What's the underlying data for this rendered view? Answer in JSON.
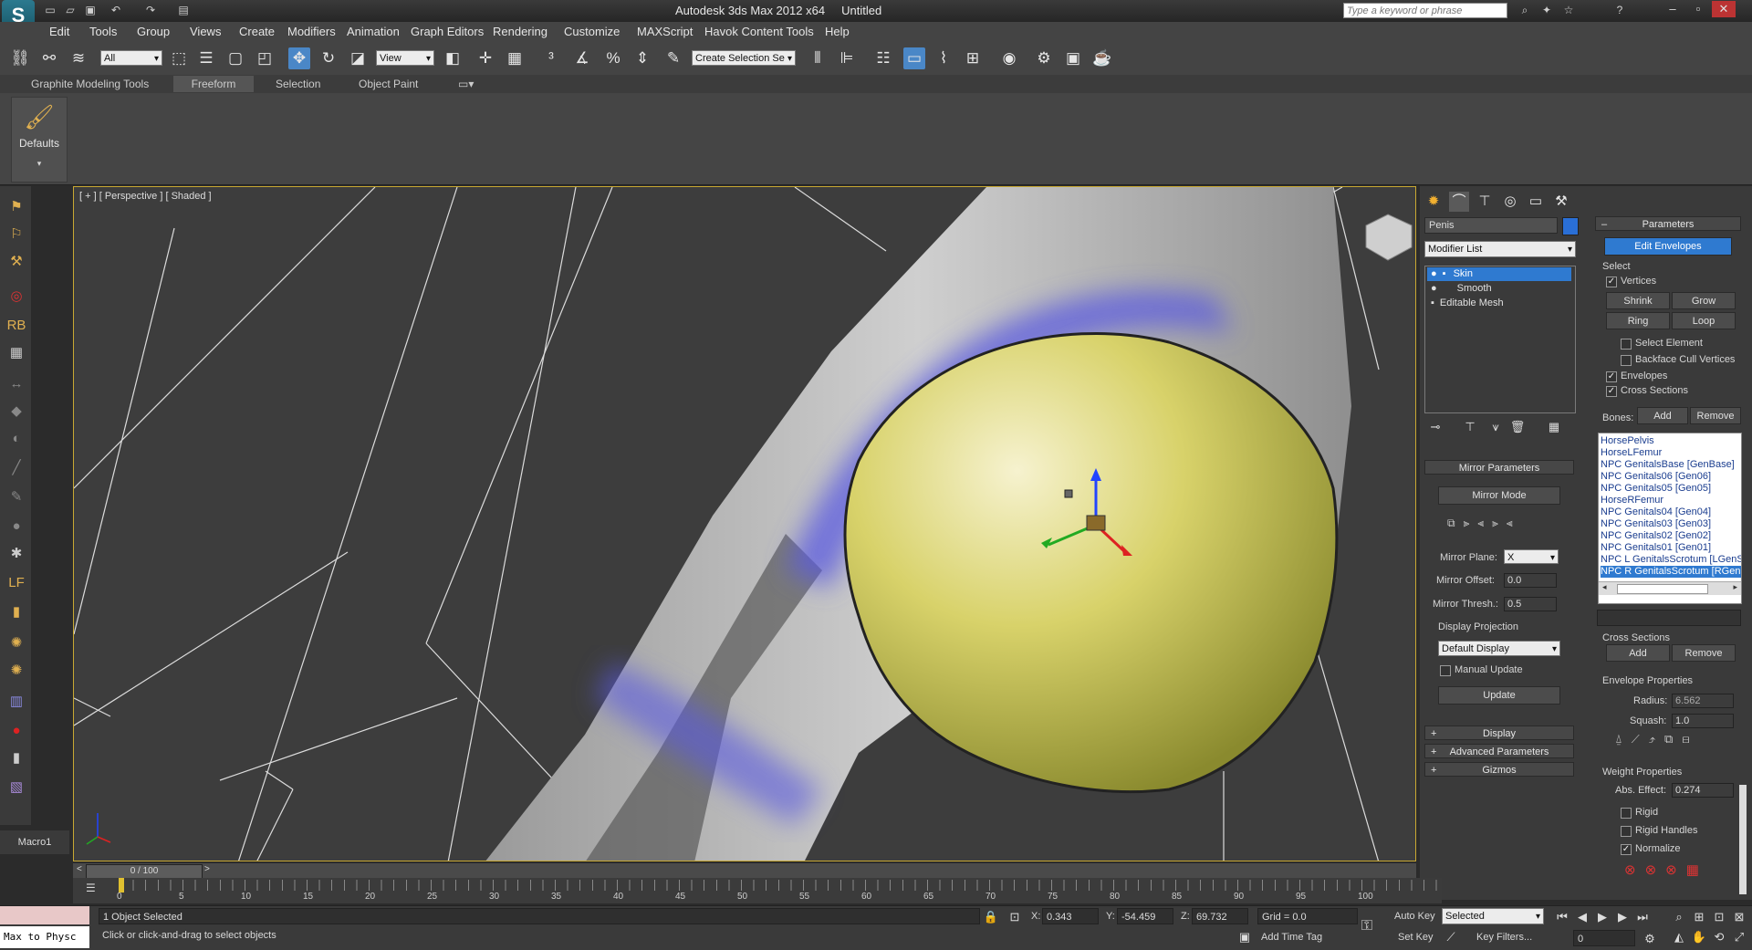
{
  "title": {
    "app": "Autodesk 3ds Max  2012 x64",
    "file": "Untitled",
    "search_placeholder": "Type a keyword or phrase"
  },
  "menu": [
    "Edit",
    "Tools",
    "Group",
    "Views",
    "Create",
    "Modifiers",
    "Animation",
    "Graph Editors",
    "Rendering",
    "Customize",
    "MAXScript",
    "Havok Content Tools",
    "Help"
  ],
  "toolbar": {
    "selection_filter": "All",
    "ref_coord": "View",
    "named_selection": "Create Selection Se"
  },
  "ribbon": {
    "tabs": [
      "Graphite Modeling Tools",
      "Freeform",
      "Selection",
      "Object Paint"
    ],
    "active_tab": "Freeform",
    "defaults_label": "Defaults"
  },
  "viewport": {
    "label": "[ + ] [ Perspective ] [ Shaded ]"
  },
  "macro_label": "Macro1",
  "command_panel": {
    "object_name": "Penis",
    "object_color": "#2a6fd6",
    "modifier_list": "Modifier List",
    "stack": [
      "Skin",
      "Smooth",
      "Editable Mesh"
    ],
    "mirror": {
      "header": "Mirror Parameters",
      "mode_button": "Mirror Mode",
      "plane_label": "Mirror Plane:",
      "plane_value": "X",
      "offset_label": "Mirror Offset:",
      "offset_value": "0.0",
      "thresh_label": "Mirror Thresh.:",
      "thresh_value": "0.5",
      "display_projection_label": "Display Projection",
      "display_projection_value": "Default Display",
      "manual_update": "Manual Update",
      "update_button": "Update"
    },
    "rollouts": [
      "Display",
      "Advanced Parameters",
      "Gizmos"
    ]
  },
  "params": {
    "header": "Parameters",
    "edit_envelopes": "Edit Envelopes",
    "select_label": "Select",
    "vertices": "Vertices",
    "shrink": "Shrink",
    "grow": "Grow",
    "ring": "Ring",
    "loop": "Loop",
    "select_element": "Select Element",
    "backface_cull": "Backface Cull Vertices",
    "envelopes": "Envelopes",
    "cross_sections": "Cross Sections",
    "bones_label": "Bones:",
    "add": "Add",
    "remove": "Remove",
    "bones": [
      "HorsePelvis",
      "HorseLFemur",
      "NPC GenitalsBase [GenBase]",
      "NPC Genitals06 [Gen06]",
      "NPC Genitals05 [Gen05]",
      "HorseRFemur",
      "NPC Genitals04 [Gen04]",
      "NPC Genitals03 [Gen03]",
      "NPC Genitals02 [Gen02]",
      "NPC Genitals01 [Gen01]",
      "NPC L GenitalsScrotum [LGenSc",
      "NPC R GenitalsScrotum [RGenSc"
    ],
    "cross_sections_group": "Cross Sections",
    "envelope_properties": "Envelope Properties",
    "radius_label": "Radius:",
    "radius_value": "6.562",
    "squash_label": "Squash:",
    "squash_value": "1.0",
    "weight_properties": "Weight Properties",
    "abs_effect_label": "Abs. Effect:",
    "abs_effect_value": "0.274",
    "rigid": "Rigid",
    "rigid_handles": "Rigid Handles",
    "normalize": "Normalize"
  },
  "timeline": {
    "slider": "0 / 100",
    "ticks": [
      "0",
      "5",
      "10",
      "15",
      "20",
      "25",
      "30",
      "35",
      "40",
      "45",
      "50",
      "55",
      "60",
      "65",
      "70",
      "75",
      "80",
      "85",
      "90",
      "95",
      "100"
    ]
  },
  "status": {
    "script_listener": "Max to Physc",
    "selected": "1 Object Selected",
    "prompt": "Click or click-and-drag to select objects",
    "x_label": "X:",
    "x_value": "0.343",
    "y_label": "Y:",
    "y_value": "-54.459",
    "z_label": "Z:",
    "z_value": "69.732",
    "grid": "Grid = 0.0",
    "add_time_tag": "Add Time Tag",
    "auto_key": "Auto Key",
    "set_key": "Set Key",
    "key_mode": "Selected",
    "key_filters": "Key Filters...",
    "frame": "0"
  }
}
